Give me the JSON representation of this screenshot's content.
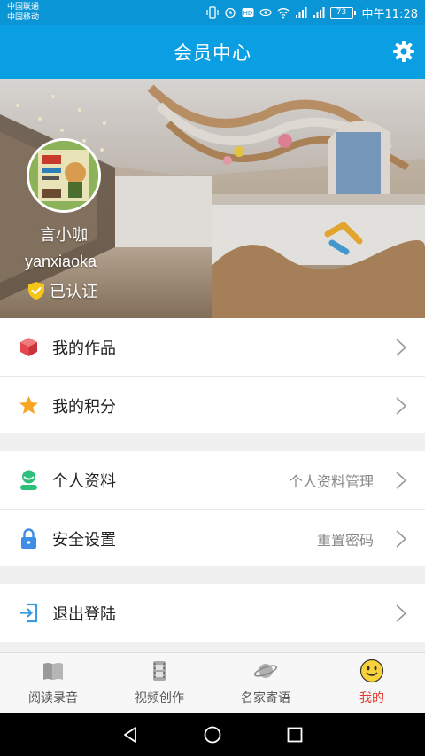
{
  "status": {
    "carrier1": "中国联通",
    "carrier2": "中国移动",
    "battery": "73",
    "time": "中午11:28"
  },
  "header": {
    "title": "会员中心"
  },
  "profile": {
    "name": "言小咖",
    "username": "yanxiaoka",
    "verified_label": "已认证"
  },
  "menu": {
    "group1": [
      {
        "label": "我的作品",
        "value": "",
        "icon": "cube-icon"
      },
      {
        "label": "我的积分",
        "value": "",
        "icon": "star-icon"
      }
    ],
    "group2": [
      {
        "label": "个人资料",
        "value": "个人资料管理",
        "icon": "person-icon"
      },
      {
        "label": "安全设置",
        "value": "重置密码",
        "icon": "lock-icon"
      }
    ],
    "group3": [
      {
        "label": "退出登陆",
        "value": "",
        "icon": "logout-icon"
      }
    ]
  },
  "tabs": [
    {
      "label": "阅读录音",
      "icon": "book-icon",
      "active": false
    },
    {
      "label": "视频创作",
      "icon": "film-icon",
      "active": false
    },
    {
      "label": "名家寄语",
      "icon": "planet-icon",
      "active": false
    },
    {
      "label": "我的",
      "icon": "smiley-icon",
      "active": true
    }
  ],
  "colors": {
    "primary": "#0a9ee3",
    "active_tab": "#e03a2f",
    "verified_badge": "#f5c518"
  }
}
